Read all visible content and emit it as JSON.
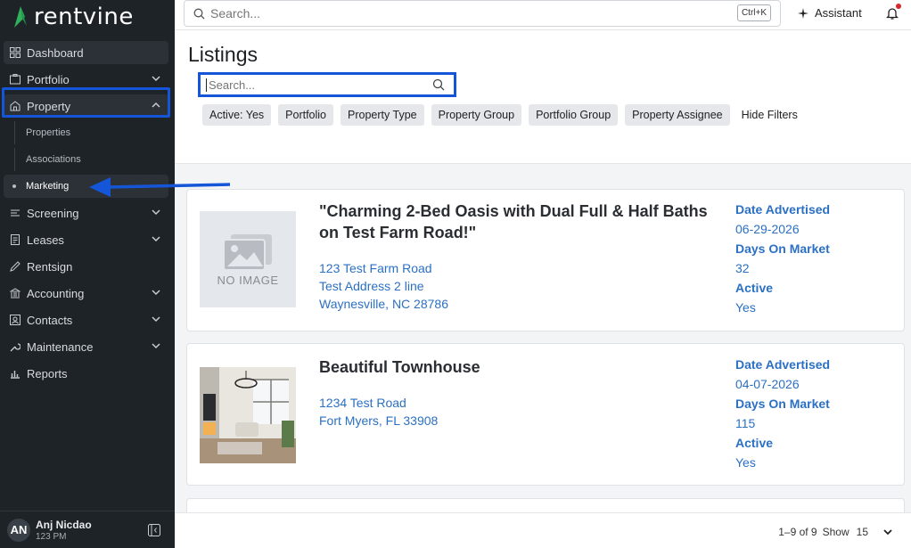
{
  "app": {
    "brand": "rentvine",
    "accent": "#1556d9",
    "link_color": "#2b70c3"
  },
  "sidebar": {
    "items": [
      {
        "label": "Dashboard",
        "icon": "dashboard-icon"
      },
      {
        "label": "Portfolio",
        "icon": "portfolio-icon"
      },
      {
        "label": "Property",
        "icon": "property-icon"
      },
      {
        "label": "Screening",
        "icon": "screening-icon"
      },
      {
        "label": "Leases",
        "icon": "leases-icon"
      },
      {
        "label": "Rentsign",
        "icon": "rentsign-icon"
      },
      {
        "label": "Accounting",
        "icon": "accounting-icon"
      },
      {
        "label": "Contacts",
        "icon": "contacts-icon"
      },
      {
        "label": "Maintenance",
        "icon": "maintenance-icon"
      },
      {
        "label": "Reports",
        "icon": "reports-icon"
      }
    ],
    "property_sub": [
      "Properties",
      "Associations",
      "Marketing"
    ],
    "user": {
      "initials": "AN",
      "name": "Anj Nicdao",
      "sub": "123 PM"
    }
  },
  "topbar": {
    "search_placeholder": "Search...",
    "shortcut": "Ctrl+K",
    "assistant_label": "Assistant"
  },
  "main": {
    "title": "Listings",
    "search_placeholder": "Search...",
    "filters": [
      "Active: Yes",
      "Portfolio",
      "Property Type",
      "Property Group",
      "Portfolio Group",
      "Property Assignee"
    ],
    "hide_filters": "Hide Filters",
    "no_image": "NO IMAGE",
    "listings": [
      {
        "title": "\"Charming 2-Bed Oasis with Dual Full & Half Baths on Test Farm Road!\"",
        "address": [
          "123 Test Farm Road",
          "Test Address 2 line",
          "Waynesville, NC 28786"
        ],
        "date_label": "Date Advertised",
        "date": "06-29-2026",
        "dom_label": "Days On Market",
        "dom": "32",
        "active_label": "Active",
        "active": "Yes"
      },
      {
        "title": "Beautiful Townhouse",
        "address": [
          "1234 Test Road",
          "Fort Myers, FL 33908"
        ],
        "date_label": "Date Advertised",
        "date": "04-07-2026",
        "dom_label": "Days On Market",
        "dom": "115",
        "active_label": "Active",
        "active": "Yes"
      }
    ],
    "pagination": {
      "range": "1–9 of 9",
      "show_label": "Show",
      "show_value": "15"
    }
  }
}
